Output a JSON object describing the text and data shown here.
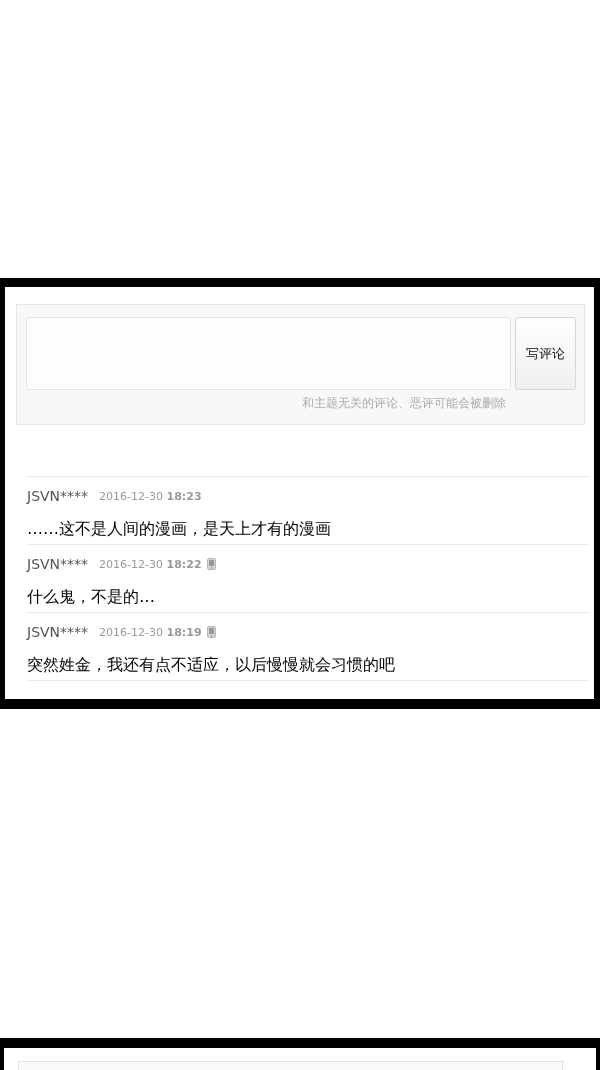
{
  "panels": [
    {
      "kind": "comments",
      "form": {
        "button": "写评论",
        "hint": "和主题无关的评论、恶评可能会被删除"
      },
      "comments": [
        {
          "user": "JSVN****",
          "time": "2016-12-30 **18:23**",
          "mobile": false,
          "text": "……这不是人间的漫画，是天上才有的漫画"
        },
        {
          "user": "JSVN****",
          "time": "2016-12-30 **18:22**",
          "mobile": true,
          "text": "什么鬼，不是的…"
        },
        {
          "user": "JSVN****",
          "time": "2016-12-30 **18:19**",
          "mobile": true,
          "text": "突然姓金，我还有点不适应，以后慢慢就会习惯的吧"
        }
      ]
    },
    {
      "kind": "blank"
    }
  ]
}
